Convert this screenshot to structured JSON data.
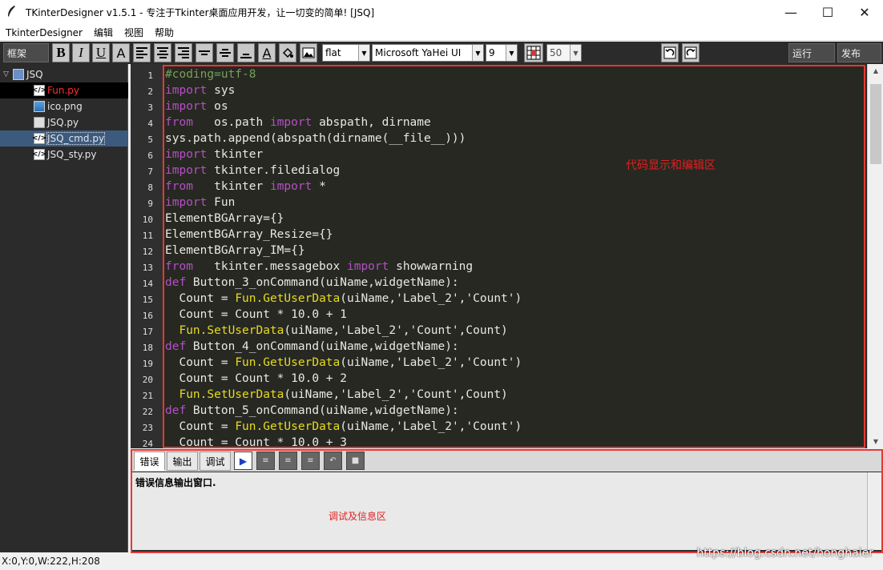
{
  "window": {
    "title": "TKinterDesigner v1.5.1 - 专注于Tkinter桌面应用开发，让一切变的简单!    [JSQ]",
    "minimize": "—",
    "maximize": "☐",
    "close": "✕"
  },
  "menu": [
    "TkinterDesigner",
    "编辑",
    "视图",
    "帮助"
  ],
  "toolbar": {
    "frame_label": "框架",
    "bold": "B",
    "italic": "I",
    "underline": "U",
    "font_letter": "A",
    "text_color_letter": "A",
    "relief": "flat",
    "font_family": "Microsoft YaHei UI",
    "font_size": "9",
    "grid_size": "50",
    "run_label": "运行",
    "publish_label": "发布"
  },
  "file_tree": {
    "project": "JSQ",
    "files": [
      {
        "name": "Fun.py",
        "icon": "python-file-icon",
        "state": "selected"
      },
      {
        "name": "ico.png",
        "icon": "image-file-icon",
        "state": ""
      },
      {
        "name": "JSQ.py",
        "icon": "form-file-icon",
        "state": ""
      },
      {
        "name": "JSQ_cmd.py",
        "icon": "python-file-icon",
        "state": "highlighted"
      },
      {
        "name": "JSQ_sty.py",
        "icon": "python-file-icon",
        "state": ""
      }
    ]
  },
  "editor": {
    "annotation": "代码显示和编辑区",
    "line_numbers": [
      "1",
      "2",
      "3",
      "4",
      "5",
      "6",
      "7",
      "8",
      "9",
      "10",
      "11",
      "12",
      "13",
      "14",
      "15",
      "16",
      "17",
      "18",
      "19",
      "20",
      "21",
      "22",
      "23",
      "24"
    ],
    "lines": [
      [
        {
          "t": "#coding=utf-8",
          "c": "cm"
        }
      ],
      [
        {
          "t": "import",
          "c": "kw"
        },
        {
          "t": " sys",
          "c": ""
        }
      ],
      [
        {
          "t": "import",
          "c": "kw"
        },
        {
          "t": " os",
          "c": ""
        }
      ],
      [
        {
          "t": "from",
          "c": "kw"
        },
        {
          "t": "   os.path ",
          "c": ""
        },
        {
          "t": "import",
          "c": "kw"
        },
        {
          "t": " abspath, dirname",
          "c": ""
        }
      ],
      [
        {
          "t": "sys.path.append(abspath(dirname(__file__)))",
          "c": ""
        }
      ],
      [
        {
          "t": "import",
          "c": "kw"
        },
        {
          "t": " tkinter",
          "c": ""
        }
      ],
      [
        {
          "t": "import",
          "c": "kw"
        },
        {
          "t": " tkinter.filedialog",
          "c": ""
        }
      ],
      [
        {
          "t": "from",
          "c": "kw"
        },
        {
          "t": "   tkinter ",
          "c": ""
        },
        {
          "t": "import",
          "c": "kw"
        },
        {
          "t": " *",
          "c": ""
        }
      ],
      [
        {
          "t": "import",
          "c": "kw"
        },
        {
          "t": " Fun",
          "c": ""
        }
      ],
      [
        {
          "t": "ElementBGArray={}",
          "c": ""
        }
      ],
      [
        {
          "t": "ElementBGArray_Resize={}",
          "c": ""
        }
      ],
      [
        {
          "t": "ElementBGArray_IM={}",
          "c": ""
        }
      ],
      [
        {
          "t": "from",
          "c": "kw"
        },
        {
          "t": "   tkinter.messagebox ",
          "c": ""
        },
        {
          "t": "import",
          "c": "kw"
        },
        {
          "t": " showwarning",
          "c": ""
        }
      ],
      [
        {
          "t": "def",
          "c": "kw"
        },
        {
          "t": " Button_3_onCommand(uiName,widgetName):",
          "c": ""
        }
      ],
      [
        {
          "t": "  Count = ",
          "c": ""
        },
        {
          "t": "Fun.GetUserData",
          "c": "fn"
        },
        {
          "t": "(uiName,'Label_2','Count')",
          "c": ""
        }
      ],
      [
        {
          "t": "  Count = Count * 10.0 + 1",
          "c": ""
        }
      ],
      [
        {
          "t": "  ",
          "c": ""
        },
        {
          "t": "Fun.SetUserData",
          "c": "fn"
        },
        {
          "t": "(uiName,'Label_2','Count',Count)",
          "c": ""
        }
      ],
      [
        {
          "t": "def",
          "c": "kw"
        },
        {
          "t": " Button_4_onCommand(uiName,widgetName):",
          "c": ""
        }
      ],
      [
        {
          "t": "  Count = ",
          "c": ""
        },
        {
          "t": "Fun.GetUserData",
          "c": "fn"
        },
        {
          "t": "(uiName,'Label_2','Count')",
          "c": ""
        }
      ],
      [
        {
          "t": "  Count = Count * 10.0 + 2",
          "c": ""
        }
      ],
      [
        {
          "t": "  ",
          "c": ""
        },
        {
          "t": "Fun.SetUserData",
          "c": "fn"
        },
        {
          "t": "(uiName,'Label_2','Count',Count)",
          "c": ""
        }
      ],
      [
        {
          "t": "def",
          "c": "kw"
        },
        {
          "t": " Button_5_onCommand(uiName,widgetName):",
          "c": ""
        }
      ],
      [
        {
          "t": "  Count = ",
          "c": ""
        },
        {
          "t": "Fun.GetUserData",
          "c": "fn"
        },
        {
          "t": "(uiName,'Label_2','Count')",
          "c": ""
        }
      ],
      [
        {
          "t": "  Count = Count * 10.0 + 3",
          "c": ""
        }
      ]
    ]
  },
  "bottom_panel": {
    "tabs": [
      "错误",
      "输出",
      "调试"
    ],
    "active_tab": "错误",
    "message": "错误信息输出窗口.",
    "annotation": "调试及信息区"
  },
  "status": {
    "coords": "X:0,Y:0,W:222,H:208"
  },
  "watermark": "https://blog.csdn.net/honghaier",
  "colors": {
    "keyword": "#b44fc4",
    "comment": "#75a05a",
    "function": "#e6db20",
    "annotation": "#e02020"
  }
}
